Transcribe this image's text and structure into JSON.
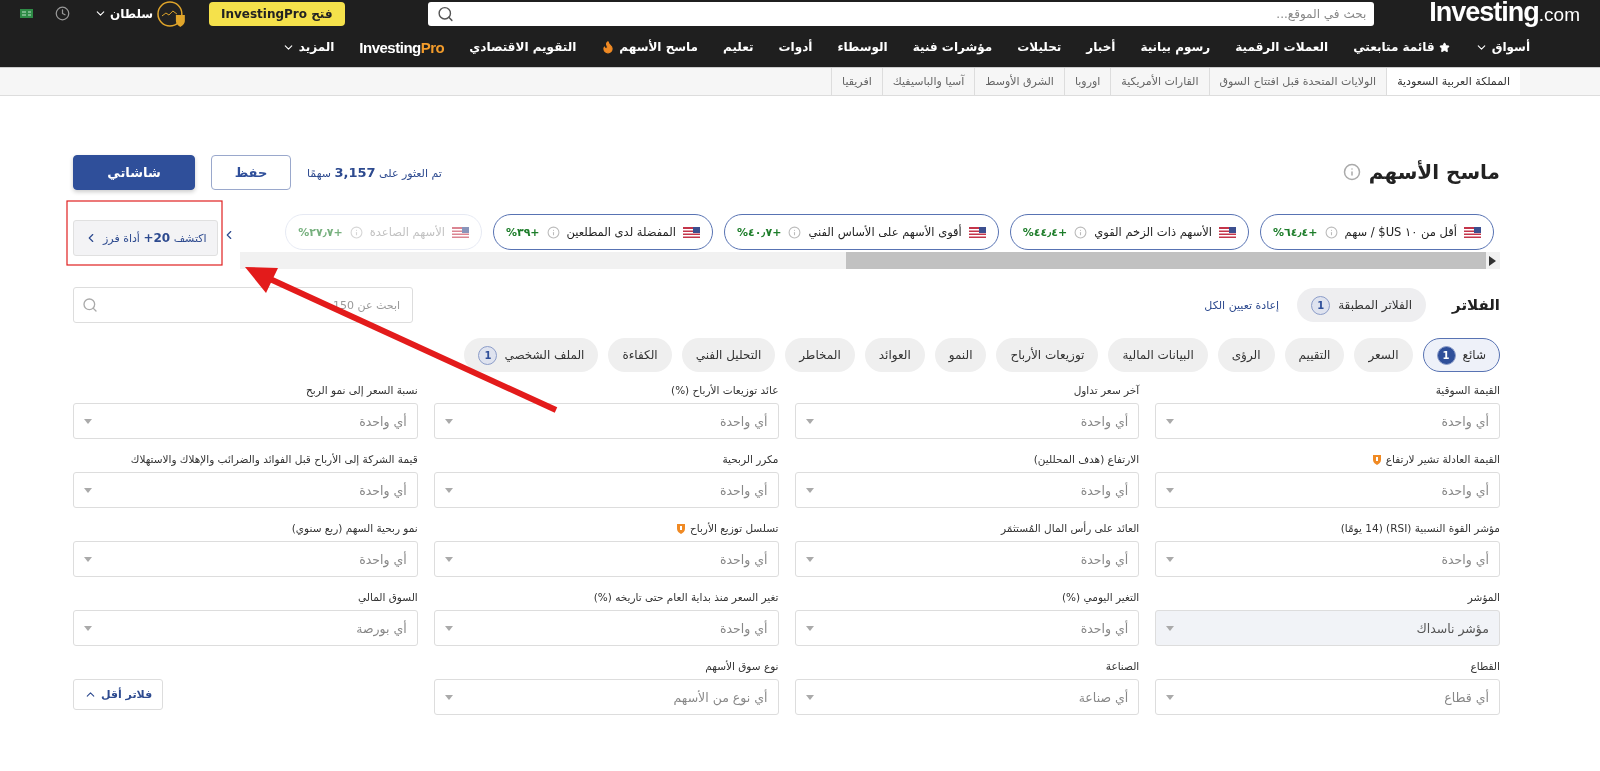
{
  "header": {
    "logo": {
      "name": "Investing",
      "suffix": ".com"
    },
    "search": {
      "placeholder": "بحث في الموقع..."
    },
    "pro_button": "فتح InvestingPro",
    "user": "سلطان"
  },
  "nav": [
    {
      "kind": "dropdown",
      "label": "أسواق"
    },
    {
      "kind": "star",
      "label": "قائمة متابعتي"
    },
    {
      "kind": "plain",
      "label": "العملات الرقمية"
    },
    {
      "kind": "plain",
      "label": "رسوم بيانية"
    },
    {
      "kind": "plain",
      "label": "أخبار"
    },
    {
      "kind": "plain",
      "label": "تحليلات"
    },
    {
      "kind": "plain",
      "label": "مؤشرات فنية"
    },
    {
      "kind": "plain",
      "label": "الوسطاء"
    },
    {
      "kind": "plain",
      "label": "أدوات"
    },
    {
      "kind": "plain",
      "label": "تعليم"
    },
    {
      "kind": "hot",
      "label": "ماسح الأسهم"
    },
    {
      "kind": "plain",
      "label": "التقويم الاقتصادي"
    },
    {
      "kind": "brand",
      "label": "Investing",
      "suffix": "Pro"
    },
    {
      "kind": "dropdown",
      "label": "المزيد"
    }
  ],
  "regions": [
    {
      "label": "المملكة العربية السعودية",
      "selected": true
    },
    {
      "label": "الولايات المتحدة قبل افتتاح السوق",
      "selected": false
    },
    {
      "label": "القارات الأمريكية",
      "selected": false
    },
    {
      "label": "اوروبا",
      "selected": false
    },
    {
      "label": "الشرق الأوسط",
      "selected": false
    },
    {
      "label": "آسيا والباسيفيك",
      "selected": false
    },
    {
      "label": "افريقيا",
      "selected": false
    }
  ],
  "page": {
    "title": "ماسح الأسهم",
    "result": "تم العثور على **3,157** سهمًا",
    "buttons": [
      {
        "kind": "outline",
        "label": "حفظ"
      },
      {
        "kind": "primary",
        "label": "شاشاتي"
      }
    ]
  },
  "presets": [
    {
      "label": "أقل من ١٠ US$ / سهم",
      "change": "+٦٤٫٤%",
      "faded": false
    },
    {
      "label": "الأسهم ذات الزخم القوي",
      "change": "+٤٤٫٤%",
      "faded": false
    },
    {
      "label": "أقوى الأسهم على الأساس الفني",
      "change": "+٤٠٫٧%",
      "faded": false
    },
    {
      "label": "المفضلة لدى المطلعين",
      "change": "+٣٩%",
      "faded": false
    },
    {
      "label": "الأسهم الصاعدة",
      "change": "+٢٧٫٧%",
      "faded": true
    }
  ],
  "discover_button": "اكتشف **20+** أداة فرز",
  "filters": {
    "title": "الفلاتر",
    "applied": {
      "label": "الفلاتر المطبقة",
      "count": "1"
    },
    "reset": "إعادة تعيين الكل",
    "search": {
      "placeholder": "ابحث عن 150"
    },
    "tabs": [
      {
        "label": "شائع",
        "count": "1",
        "selected": true
      },
      {
        "label": "السعر",
        "selected": false
      },
      {
        "label": "التقييم",
        "selected": false
      },
      {
        "label": "الرؤى",
        "selected": false
      },
      {
        "label": "البيانات المالية",
        "selected": false
      },
      {
        "label": "توزيعات الأرباح",
        "selected": false
      },
      {
        "label": "النمو",
        "selected": false
      },
      {
        "label": "العوائد",
        "selected": false
      },
      {
        "label": "المخاطر",
        "selected": false
      },
      {
        "label": "التحليل الفني",
        "selected": false
      },
      {
        "label": "الكفاءة",
        "selected": false
      },
      {
        "label": "الملف الشخصي",
        "count": "1",
        "selected": false
      }
    ],
    "fields": [
      {
        "label": "القيمة السوقية",
        "value": "أي واحدة",
        "pro": false,
        "active": false
      },
      {
        "label": "آخر سعر تداول",
        "value": "أي واحدة",
        "pro": false,
        "active": false
      },
      {
        "label": "عائد توزيعات الأرباح (%)",
        "value": "أي واحدة",
        "pro": false,
        "active": false
      },
      {
        "label": "نسبة السعر إلى نمو الربح",
        "value": "أي واحدة",
        "pro": false,
        "active": false
      },
      {
        "label": "القيمة العادلة تشير لارتفاع",
        "value": "أي واحدة",
        "pro": true,
        "active": false
      },
      {
        "label": "الارتفاع (هدف المحللين)",
        "value": "أي واحدة",
        "pro": false,
        "active": false
      },
      {
        "label": "مكرر الربحية",
        "value": "أي واحدة",
        "pro": false,
        "active": false
      },
      {
        "label": "قيمة الشركة إلى الأرباح قبل الفوائد والضرائب والإهلاك والاستهلاك",
        "value": "أي واحدة",
        "pro": false,
        "active": false
      },
      {
        "label": "مؤشر القوة النسبية (RSI) (14 يومًا)",
        "value": "أي واحدة",
        "pro": false,
        "active": false
      },
      {
        "label": "العائد على رأس المال المُستثمَر",
        "value": "أي واحدة",
        "pro": false,
        "active": false
      },
      {
        "label": "تسلسل توزيع الأرباح",
        "value": "أي واحدة",
        "pro": true,
        "active": false
      },
      {
        "label": "نمو ربحية السهم (ربع سنوي)",
        "value": "أي واحدة",
        "pro": false,
        "active": false
      },
      {
        "label": "المؤشر",
        "value": "مؤشر ناسداك",
        "pro": false,
        "active": true
      },
      {
        "label": "التغير اليومي (%)",
        "value": "أي واحدة",
        "pro": false,
        "active": false
      },
      {
        "label": "تغير السعر منذ بداية العام حتى تاريخه (%)",
        "value": "أي واحدة",
        "pro": false,
        "active": false
      },
      {
        "label": "السوق المالي",
        "value": "أي بورصة",
        "pro": false,
        "active": false
      },
      {
        "label": "القطاع",
        "value": "أي قطاع",
        "pro": false,
        "active": false
      },
      {
        "label": "الصناعة",
        "value": "أي صناعة",
        "pro": false,
        "active": false
      },
      {
        "label": "نوع سوق الأسهم",
        "value": "أي نوع من الأسهم",
        "pro": false,
        "active": false
      }
    ],
    "fewer_button": "فلاتر أقل"
  }
}
